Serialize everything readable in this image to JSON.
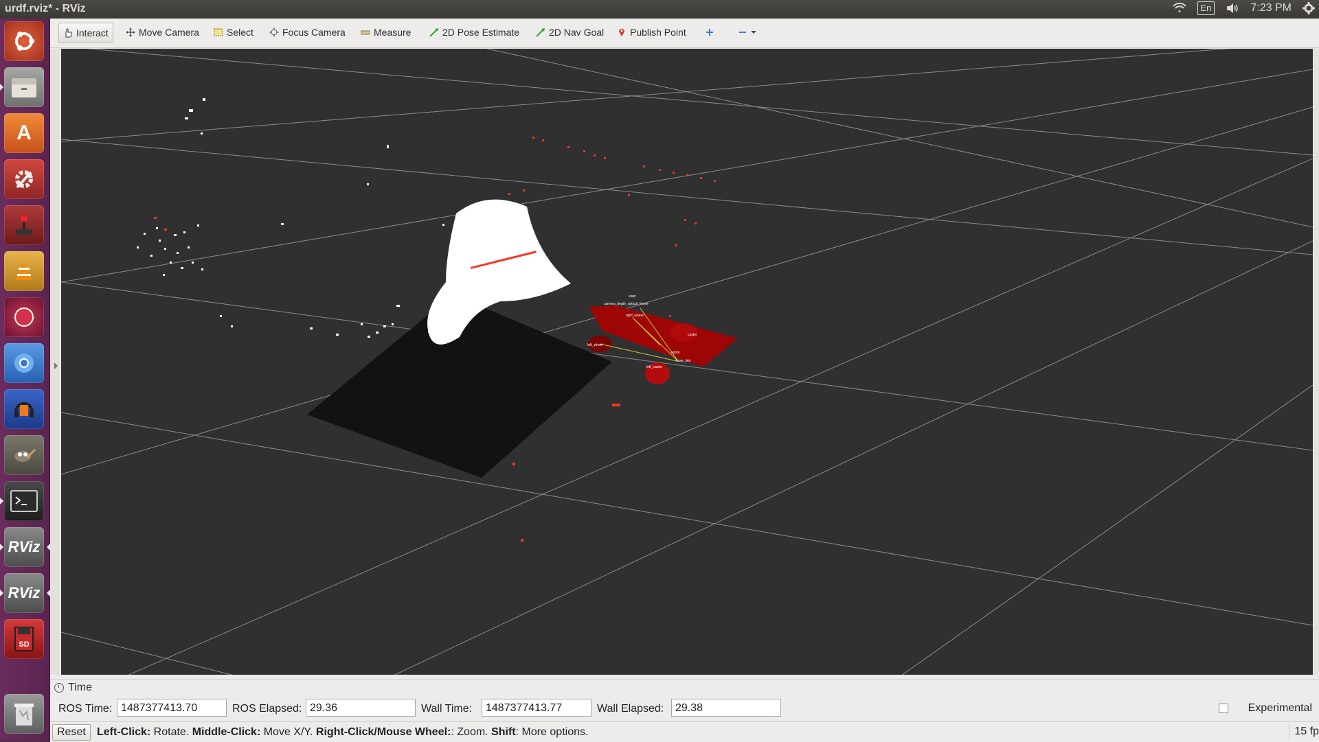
{
  "window": {
    "title": "urdf.rviz* - RViz"
  },
  "tray": {
    "language": "En",
    "time": "7:23 PM"
  },
  "launcher": {
    "items": [
      {
        "name": "ubuntu-dash",
        "color": "#c94a2a"
      },
      {
        "name": "files",
        "color": "#8a8a88"
      },
      {
        "name": "software-center",
        "color": "#e0762a"
      },
      {
        "name": "system-settings",
        "color": "#b53a33"
      },
      {
        "name": "joystick-app",
        "color": "#9a2a2a"
      },
      {
        "name": "vlc",
        "color": "#d8a23a"
      },
      {
        "name": "app-red-circle",
        "color": "#8a1a3a"
      },
      {
        "name": "chromium",
        "color": "#3b78c9"
      },
      {
        "name": "audacity",
        "color": "#2a4ea6"
      },
      {
        "name": "gimp",
        "color": "#6d6a5e"
      },
      {
        "name": "terminal",
        "color": "#3a3a3a"
      },
      {
        "name": "rviz-1",
        "label": "RViz",
        "color": "#6b6b6b"
      },
      {
        "name": "rviz-2",
        "label": "RViz",
        "color": "#6b6b6b"
      },
      {
        "name": "sd-card",
        "label": "SD",
        "color": "#b3242e"
      },
      {
        "name": "trash",
        "color": "#8b8b8b"
      }
    ]
  },
  "toolbar": {
    "interact": "Interact",
    "move_camera": "Move Camera",
    "select": "Select",
    "focus_camera": "Focus Camera",
    "measure": "Measure",
    "pose_estimate": "2D Pose Estimate",
    "nav_goal": "2D Nav Goal",
    "publish_point": "Publish Point"
  },
  "viewport": {
    "robot_labels": [
      "camera_depth_optical_frame",
      "laser",
      "right_wheel",
      "left_wheel",
      "base_link",
      "odom",
      "caster",
      "left_caster"
    ]
  },
  "time_panel": {
    "title": "Time",
    "ros_time_label": "ROS Time:",
    "ros_time": "1487377413.70",
    "ros_elapsed_label": "ROS Elapsed:",
    "ros_elapsed": "29.36",
    "wall_time_label": "Wall Time:",
    "wall_time": "1487377413.77",
    "wall_elapsed_label": "Wall Elapsed:",
    "wall_elapsed": "29.38",
    "experimental": "Experimental"
  },
  "status": {
    "reset": "Reset",
    "left_click": "Left-Click:",
    "left_click_desc": " Rotate. ",
    "middle_click": "Middle-Click:",
    "middle_click_desc": " Move X/Y. ",
    "right_click": "Right-Click/Mouse Wheel:",
    "right_click_desc": ": Zoom. ",
    "shift": "Shift",
    "shift_desc": ": More options.",
    "fps": "15 fp"
  }
}
